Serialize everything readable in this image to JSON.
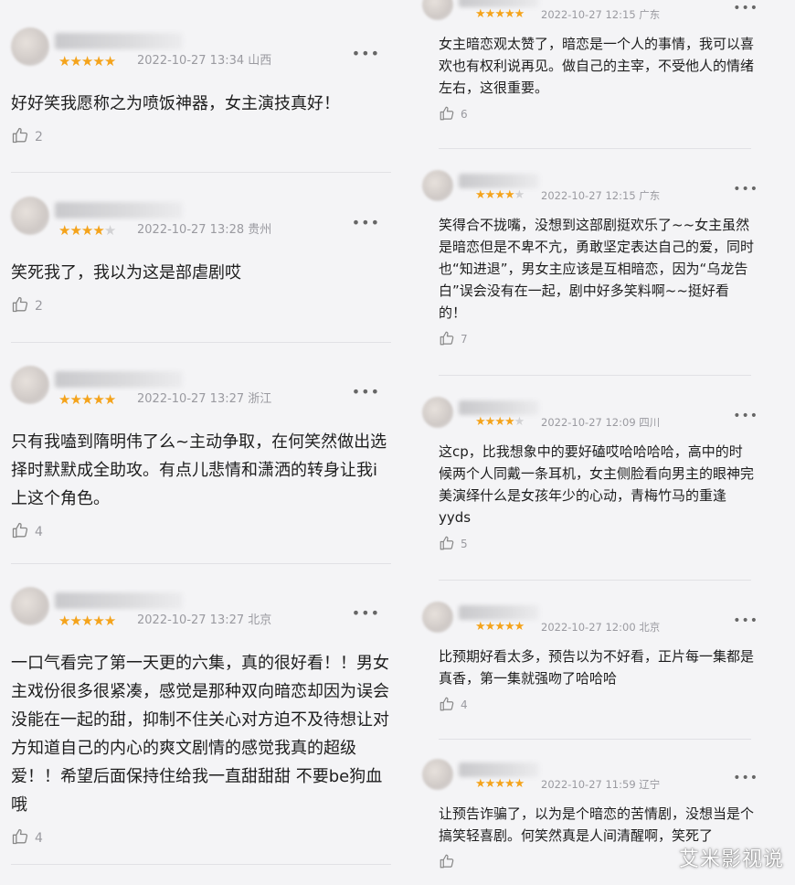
{
  "left": [
    {
      "stars": 5,
      "date": "2022-10-27 13:34",
      "loc": "山西",
      "text": "好好笑我愿称之为喷饭神器，女主演技真好！",
      "likes": "2"
    },
    {
      "stars": 4,
      "date": "2022-10-27 13:28",
      "loc": "贵州",
      "text": "笑死我了，我以为这是部虐剧哎",
      "likes": "2"
    },
    {
      "stars": 5,
      "date": "2022-10-27 13:27",
      "loc": "浙江",
      "text": "只有我嗑到隋明伟了么~主动争取，在何笑然做出选择时默默成全助攻。有点儿悲情和潇洒的转身让我i上这个角色。",
      "likes": "4"
    },
    {
      "stars": 5,
      "date": "2022-10-27 13:27",
      "loc": "北京",
      "text": "一口气看完了第一天更的六集，真的很好看！！男女主戏份很多很紧凑，感觉是那种双向暗恋却因为误会没能在一起的甜，抑制不住关心对方迫不及待想让对方知道自己的内心的爽文剧情的感觉我真的超级爱！！希望后面保持住给我一直甜甜甜 不要be狗血哦",
      "likes": "4"
    }
  ],
  "right": [
    {
      "stars": 5,
      "date": "2022-10-27 12:15",
      "loc": "广东",
      "text": "女主暗恋观太赞了，暗恋是一个人的事情，我可以喜欢也有权利说再见。做自己的主宰，不受他人的情绪左右，这很重要。",
      "likes": "6"
    },
    {
      "stars": 4,
      "date": "2022-10-27 12:15",
      "loc": "广东",
      "text": "笑得合不拢嘴，没想到这部剧挺欢乐了~~女主虽然是暗恋但是不卑不亢，勇敢坚定表达自己的爱，同时也“知进退”，男女主应该是互相暗恋，因为“乌龙告白”误会没有在一起，剧中好多笑料啊~~挺好看的！",
      "likes": "7"
    },
    {
      "stars": 4,
      "date": "2022-10-27 12:09",
      "loc": "四川",
      "text": "这cp，比我想象中的要好磕哎哈哈哈哈，高中的时候两个人同戴一条耳机，女主侧脸看向男主的眼神完美演绎什么是女孩年少的心动，青梅竹马的重逢yyds",
      "likes": "5"
    },
    {
      "stars": 5,
      "date": "2022-10-27 12:00",
      "loc": "北京",
      "text": "比预期好看太多，预告以为不好看，正片每一集都是真香，第一集就强吻了哈哈哈",
      "likes": "4"
    },
    {
      "stars": 5,
      "date": "2022-10-27 11:59",
      "loc": "辽宁",
      "text": "让预告诈骗了，以为是个暗恋的苦情剧，没想当是个搞笑轻喜剧。何笑然真是人间清醒啊，笑死了",
      "likes": ""
    }
  ],
  "more_glyph": "•••",
  "star_glyph": "★",
  "watermark": "艾米影视说",
  "colors": {
    "star_on": "#f4a31b",
    "star_off": "#d2d2d4",
    "meta": "#9a9aa0",
    "bg": "#f4f4f6"
  }
}
